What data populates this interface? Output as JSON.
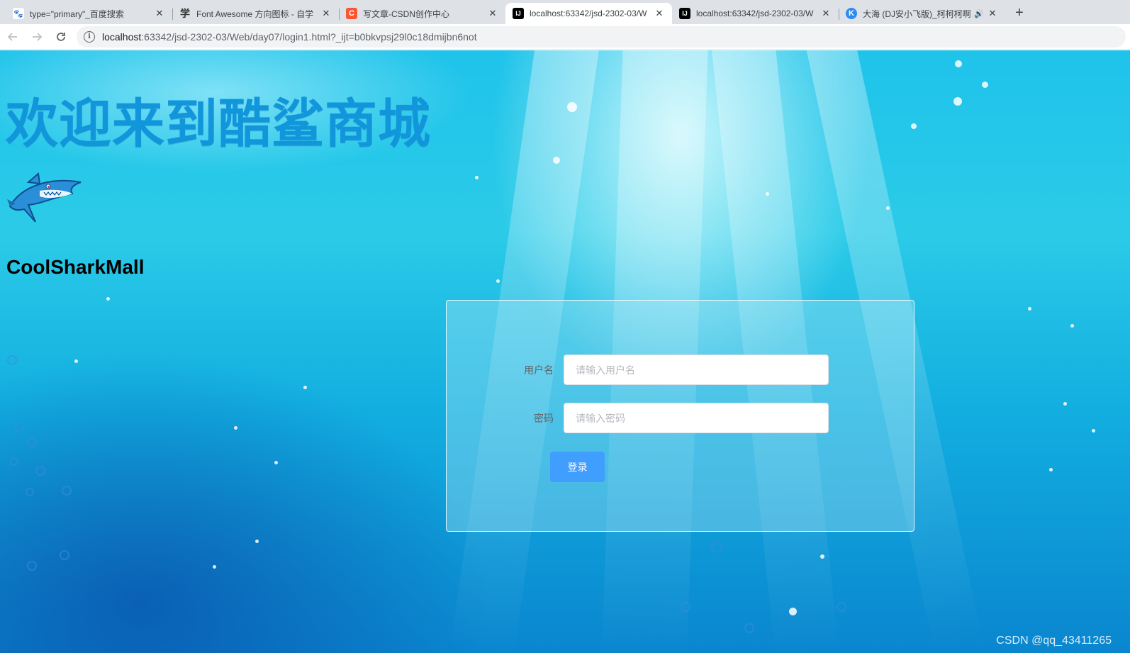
{
  "browser": {
    "tabs": [
      {
        "title": "type=\"primary\"_百度搜索",
        "icon": "baidu-paw-icon",
        "active": false
      },
      {
        "title": "Font Awesome 方向图标 - 自学",
        "icon": "xue-icon",
        "active": false
      },
      {
        "title": "写文章-CSDN创作中心",
        "icon": "csdn-icon",
        "active": false
      },
      {
        "title": "localhost:63342/jsd-2302-03/W",
        "icon": "intellij-icon",
        "active": true
      },
      {
        "title": "localhost:63342/jsd-2302-03/W",
        "icon": "intellij-icon",
        "active": false
      },
      {
        "title": "大海 (DJ安小飞版)_柯柯柯啊",
        "icon": "kugou-icon",
        "active": false,
        "audio": true
      }
    ],
    "new_tab_label": "+",
    "close_glyph": "✕",
    "audio_glyph": "🔊",
    "url_host": "localhost",
    "url_rest": ":63342/jsd-2302-03/Web/day07/login1.html?_ijt=b0bkvpsj29l0c18dmijbn6not",
    "info_glyph": "i"
  },
  "page": {
    "welcome_title": "欢迎来到酷鲨商城",
    "brand_name": "CoolSharkMall",
    "logo_icon": "shark-logo-icon",
    "accent_color": "#1296db",
    "login": {
      "username_label": "用户名",
      "username_placeholder": "请输入用户名",
      "username_value": "",
      "password_label": "密码",
      "password_placeholder": "请输入密码",
      "password_value": "",
      "submit_label": "登录",
      "button_color": "#409eff"
    },
    "watermark": "CSDN @qq_43411265"
  }
}
